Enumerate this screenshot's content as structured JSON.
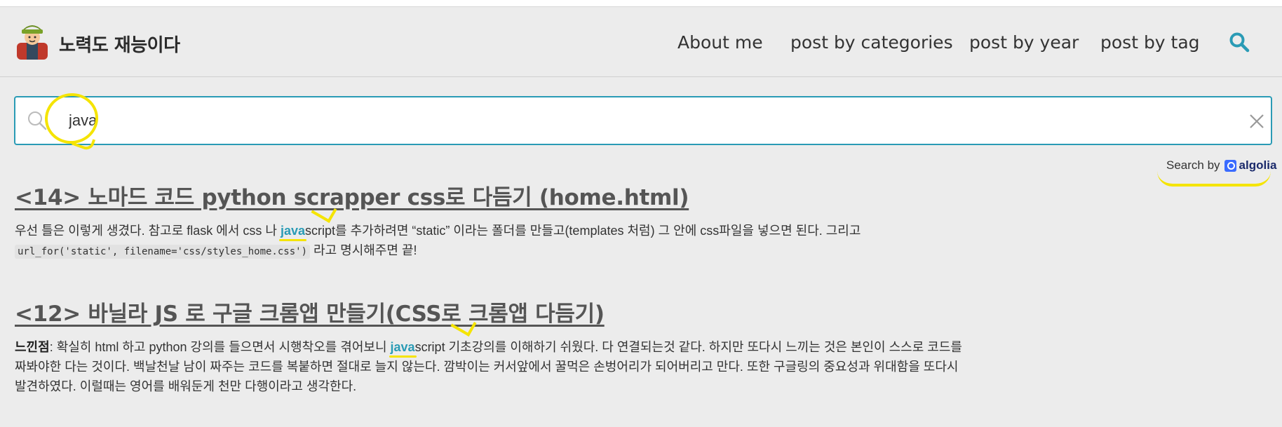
{
  "site": {
    "title": "노력도 재능이다"
  },
  "nav": {
    "items": [
      {
        "label": "About me"
      },
      {
        "label": "post by categories"
      },
      {
        "label": "post by year"
      },
      {
        "label": "post by tag"
      }
    ]
  },
  "search": {
    "value": "java",
    "placeholder": "",
    "provider_label": "Search by",
    "provider_name": "algolia"
  },
  "results": [
    {
      "title": "<14> 노마드 코드 python scrapper css로 다듬기 (home.html)",
      "pre_text": "우선 틀은 이렇게 생겼다. 참고로 flask 에서 css 나 ",
      "match": "java",
      "post_text": "script를 추가하려면 “static” 이라는 폴더를 만들고(templates 처럼) 그 안에 css파일을 넣으면 된다. 그리고",
      "code": "url_for('static', filename='css/styles_home.css')",
      "tail_text": " 라고 명시해주면 끝!"
    },
    {
      "title": "<12> 바닐라 JS 로 구글 크롬앱 만들기(CSS로 크롬앱 다듬기)",
      "lead_strong": "느낀점",
      "pre_text": ": 확실히 html 하고 python 강의를 들으면서 시행착오를 겪어보니 ",
      "match": "java",
      "post_text": "script 기초강의를 이해하기 쉬웠다. 다 연결되는것 같다. 하지만 또다시 느끼는 것은 본인이 스스로 코드를 짜봐야한 다는 것이다. 백날천날 남이 짜주는 코드를 복붙하면 절대로 늘지 않는다. 깜박이는 커서앞에서 꿀먹은 손벙어리가 되어버리고 만다. 또한 구글링의 중요성과 위대함을 또다시 발견하였다. 이럴때는 영어를 배워둔게 천만 다행이라고 생각한다."
    }
  ],
  "colors": {
    "accent": "#2a9bb5",
    "highlight": "#f5e400",
    "background": "#ececec"
  }
}
